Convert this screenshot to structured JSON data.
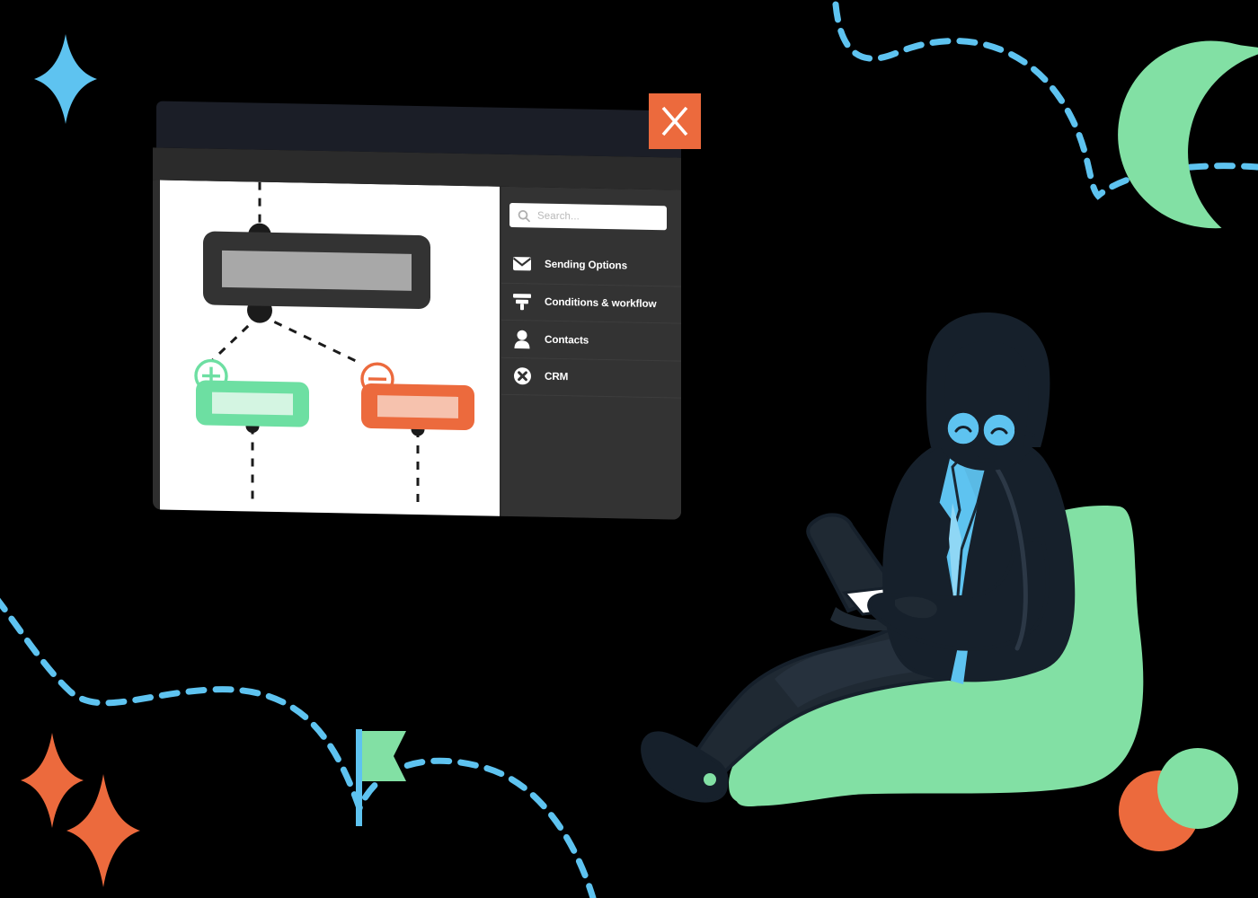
{
  "window": {
    "close_label": "X",
    "search": {
      "placeholder": "Search...",
      "icon": "search-icon"
    },
    "menu": [
      {
        "label": "Sending Options",
        "icon": "envelope-icon"
      },
      {
        "label": "Conditions & workflow",
        "icon": "filter-icon"
      },
      {
        "label": "Contacts",
        "icon": "person-icon"
      },
      {
        "label": "CRM",
        "icon": "circle-x-icon"
      }
    ],
    "flow": {
      "main_node": {
        "name": "main-step-node"
      },
      "branch_positive": {
        "icon": "plus-circle-icon",
        "node": "positive-branch-node"
      },
      "branch_negative": {
        "icon": "minus-circle-icon",
        "node": "negative-branch-node"
      }
    }
  },
  "colors": {
    "background": "#000000",
    "titlebar": "#1b1e27",
    "toolbar": "#2b2b2b",
    "sidebar": "#333333",
    "canvas": "#ffffff",
    "accent_orange": "#ec6a3d",
    "accent_green": "#6ddfa2",
    "accent_blue": "#5ec3f0",
    "node_grey": "#a8a8a8",
    "green_inner": "#d4f5e2",
    "orange_inner": "#f6c2ae",
    "beanbag_green": "#82e0a4",
    "dark_figure": "#16202b"
  },
  "decor": {
    "sparkle_blue": "sparkle-blue",
    "sparkle_orange_1": "sparkle-orange-large",
    "sparkle_orange_2": "sparkle-orange-small",
    "moon": "crescent-moon-green",
    "flag": "flag-green",
    "circle_orange": "circle-orange",
    "circle_green": "circle-green",
    "dashed_path_top": "dashed-path-top-right",
    "dashed_path_bottom": "dashed-path-bottom-left"
  },
  "character": {
    "name": "woman-with-laptop-on-beanbag",
    "laptop": "laptop",
    "glasses": "round-glasses",
    "beanbag": "beanbag-chair"
  }
}
